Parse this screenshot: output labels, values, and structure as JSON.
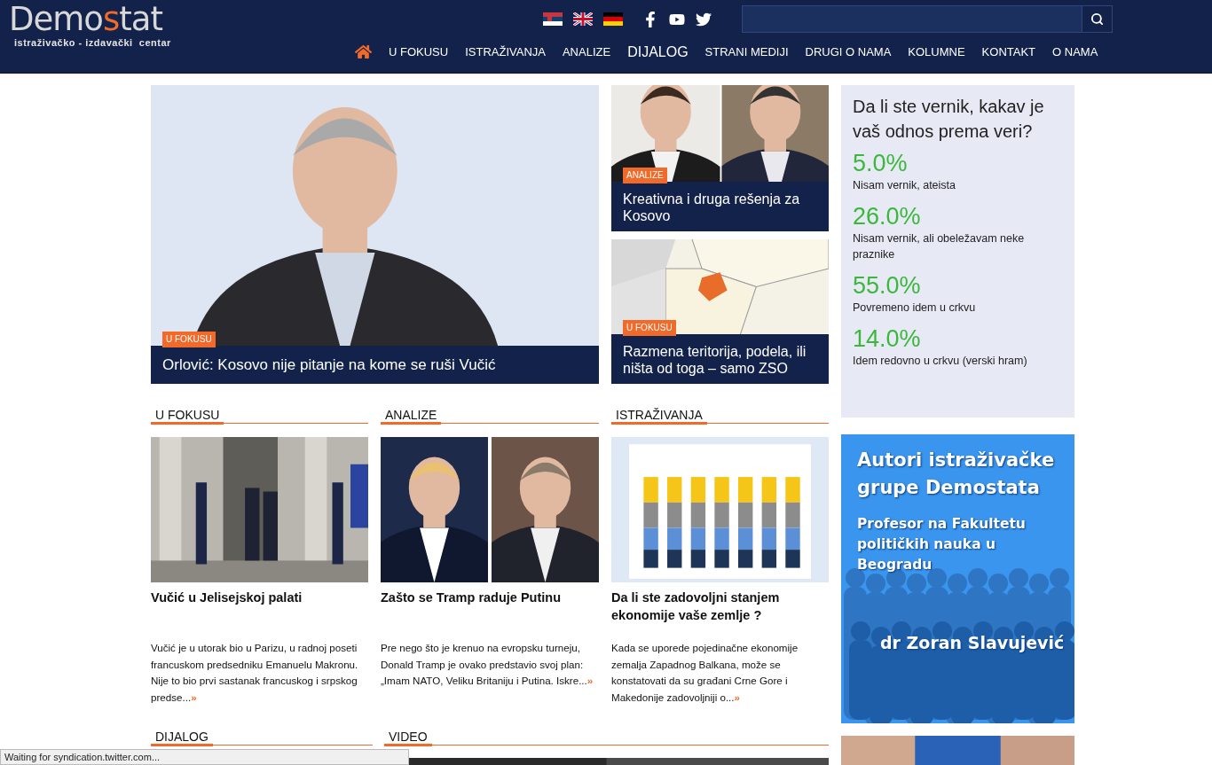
{
  "header": {
    "logo": {
      "name_start": "Demo",
      "name_accent": "s",
      "name_end": "tat",
      "tagline": "istraživačko - izdavački  centar"
    },
    "nav": [
      {
        "label": "U FOKUSU",
        "selected": false
      },
      {
        "label": "ISTRAŽIVANJA",
        "selected": false
      },
      {
        "label": "ANALIZE",
        "selected": false
      },
      {
        "label": "DIJALOG",
        "selected": true
      },
      {
        "label": "STRANI MEDIJI",
        "selected": false
      },
      {
        "label": "DRUGI O NAMA",
        "selected": false
      },
      {
        "label": "KOLUMNE",
        "selected": false
      },
      {
        "label": "KONTAKT",
        "selected": false
      },
      {
        "label": "O NAMA",
        "selected": false
      }
    ]
  },
  "hero": {
    "badge": "U FOKUSU",
    "title": "Orlović: Kosovo nije pitanje na kome se ruši Vučić"
  },
  "side_stories": [
    {
      "badge": "ANALIZE",
      "title": "Kreativna i druga rešenja za Kosovo"
    },
    {
      "badge": "U FOKUSU",
      "title": "Razmena teritorija, podela, ili ništa od toga – samo ZSO"
    }
  ],
  "poll": {
    "question": "Da li ste vernik, kakav je vaš odnos prema veri?",
    "answers": [
      {
        "percent": "5.0%",
        "label": "Nisam vernik, ateista"
      },
      {
        "percent": "26.0%",
        "label": "Nisam vernik, ali obeležavam neke praznike"
      },
      {
        "percent": "55.0%",
        "label": "Povremeno idem u crkvu"
      },
      {
        "percent": "14.0%",
        "label": "Idem redovno u crkvu (verski hram)"
      }
    ]
  },
  "sections": [
    {
      "heading": "U FOKUSU",
      "title": "Vučić u Jelisejskoj palati",
      "excerpt": "Vučić je u utorak bio u Parizu, u radnoj poseti francuskom predsedniku Emanuelu Makronu. Nije to bio prvi sastanak francuskog i srpskog predse...",
      "more": "»"
    },
    {
      "heading": "ANALIZE",
      "title": "Zašto se Tramp raduje Putinu",
      "excerpt": "Pre nego što je krenuo na evropsku turneju, Donald Tramp je ovako predstavio svoj plan: „Imam NATO, Veliku Britaniju i Putina. Iskre...",
      "more": "»"
    },
    {
      "heading": "ISTRAŽIVANJA",
      "title": "Da li ste zadovoljni stanjem ekonomije vaše zemlje ?",
      "excerpt": "Kada se uporede pojedinačne ekonomije zemalja Zapadnog Balkana, može se konstatovati  da su građani Crne Gore i Makedonije zadovoljniji o...",
      "more": "»"
    }
  ],
  "banner": {
    "title": "Autori istraživačke grupe Demostata",
    "subtitle": "Profesor na Fakultetu političkih nauka u Beogradu",
    "name": "dr Zoran Slavujević"
  },
  "bottom_sections": [
    {
      "heading": "DIJALOG"
    },
    {
      "heading": "VIDEO"
    }
  ],
  "status_bar": "Waiting for syndication.twitter.com..."
}
